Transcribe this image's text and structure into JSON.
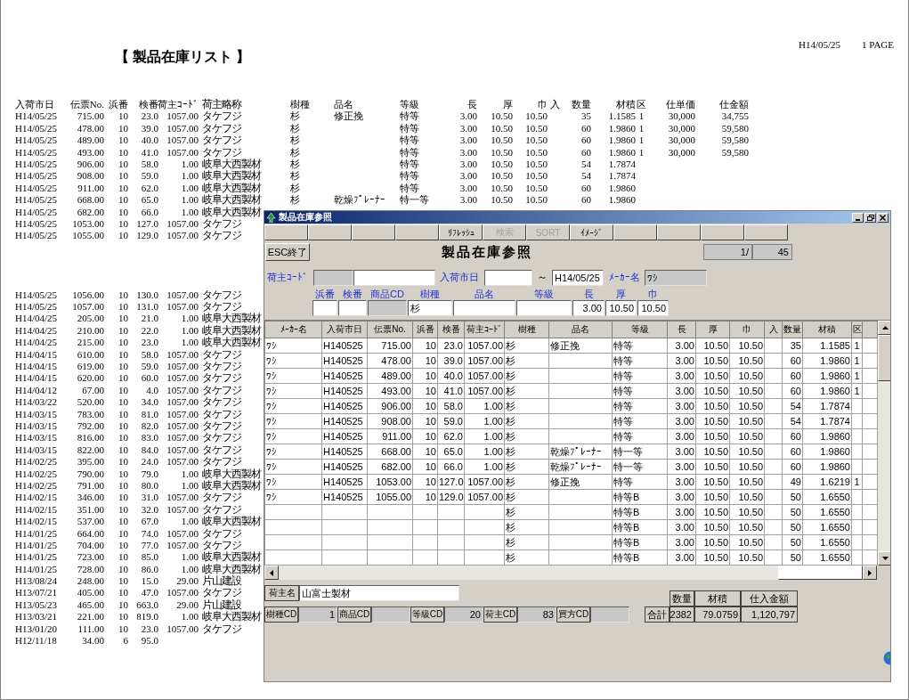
{
  "report": {
    "title": "【 製品在庫リスト 】",
    "date": "H14/05/25",
    "page": "1 PAGE",
    "columns": [
      "入荷市日",
      "伝票No.",
      "浜番",
      "検番",
      "荷主ｺｰﾄﾞ",
      "荷主略称",
      "樹種",
      "品名",
      "等級",
      "長",
      "厚",
      "巾",
      "入",
      "数量",
      "材積",
      "区",
      "仕単価",
      "仕金額"
    ],
    "blocks": [
      {
        "rows": [
          {
            "date": "H14/05/25",
            "slip": "715.00",
            "hama": "10",
            "ken": "23.0",
            "code": "1057.00",
            "owner": "タケフジ",
            "species": "杉",
            "item": "修正挽",
            "grade": "特等",
            "len": "3.00",
            "thk": "10.50",
            "wid": "10.50",
            "qty": "35",
            "vol": "1.1585",
            "ku": "1",
            "price": "30,000",
            "amount": "34,755"
          },
          {
            "date": "H14/05/25",
            "slip": "478.00",
            "hama": "10",
            "ken": "39.0",
            "code": "1057.00",
            "owner": "タケフジ",
            "species": "杉",
            "grade": "特等",
            "len": "3.00",
            "thk": "10.50",
            "wid": "10.50",
            "qty": "60",
            "vol": "1.9860",
            "ku": "1",
            "price": "30,000",
            "amount": "59,580"
          },
          {
            "date": "H14/05/25",
            "slip": "489.00",
            "hama": "10",
            "ken": "40.0",
            "code": "1057.00",
            "owner": "タケフジ",
            "species": "杉",
            "grade": "特等",
            "len": "3.00",
            "thk": "10.50",
            "wid": "10.50",
            "qty": "60",
            "vol": "1.9860",
            "ku": "1",
            "price": "30,000",
            "amount": "59,580"
          },
          {
            "date": "H14/05/25",
            "slip": "493.00",
            "hama": "10",
            "ken": "41.0",
            "code": "1057.00",
            "owner": "タケフジ",
            "species": "杉",
            "grade": "特等",
            "len": "3.00",
            "thk": "10.50",
            "wid": "10.50",
            "qty": "60",
            "vol": "1.9860",
            "ku": "1",
            "price": "30,000",
            "amount": "59,580"
          },
          {
            "date": "H14/05/25",
            "slip": "906.00",
            "hama": "10",
            "ken": "58.0",
            "code": "1.00",
            "owner": "岐阜大西製材",
            "species": "杉",
            "grade": "特等",
            "len": "3.00",
            "thk": "10.50",
            "wid": "10.50",
            "qty": "54",
            "vol": "1.7874"
          },
          {
            "date": "H14/05/25",
            "slip": "908.00",
            "hama": "10",
            "ken": "59.0",
            "code": "1.00",
            "owner": "岐阜大西製材",
            "species": "杉",
            "grade": "特等",
            "len": "3.00",
            "thk": "10.50",
            "wid": "10.50",
            "qty": "54",
            "vol": "1.7874"
          },
          {
            "date": "H14/05/25",
            "slip": "911.00",
            "hama": "10",
            "ken": "62.0",
            "code": "1.00",
            "owner": "岐阜大西製材",
            "species": "杉",
            "grade": "特等",
            "len": "3.00",
            "thk": "10.50",
            "wid": "10.50",
            "qty": "60",
            "vol": "1.9860"
          },
          {
            "date": "H14/05/25",
            "slip": "668.00",
            "hama": "10",
            "ken": "65.0",
            "code": "1.00",
            "owner": "岐阜大西製材",
            "species": "杉",
            "item": "乾燥ﾌﾟﾚｰﾅｰ",
            "grade": "特一等",
            "len": "3.00",
            "thk": "10.50",
            "wid": "10.50",
            "qty": "60",
            "vol": "1.9860"
          },
          {
            "date": "H14/05/25",
            "slip": "682.00",
            "hama": "10",
            "ken": "66.0",
            "code": "1.00",
            "owner": "岐阜大西製材"
          },
          {
            "date": "H14/05/25",
            "slip": "1053.00",
            "hama": "10",
            "ken": "127.0",
            "code": "1057.00",
            "owner": "タケフジ"
          },
          {
            "date": "H14/05/25",
            "slip": "1055.00",
            "hama": "10",
            "ken": "129.0",
            "code": "1057.00",
            "owner": "タケフジ"
          }
        ]
      },
      {
        "rows": [
          {
            "date": "H14/05/25",
            "slip": "1056.00",
            "hama": "10",
            "ken": "130.0",
            "code": "1057.00",
            "owner": "タケフジ"
          },
          {
            "date": "H14/05/25",
            "slip": "1057.00",
            "hama": "10",
            "ken": "131.0",
            "code": "1057.00",
            "owner": "タケフジ"
          },
          {
            "date": "H14/04/25",
            "slip": "205.00",
            "hama": "10",
            "ken": "21.0",
            "code": "1.00",
            "owner": "岐阜大西製材"
          },
          {
            "date": "H14/04/25",
            "slip": "210.00",
            "hama": "10",
            "ken": "22.0",
            "code": "1.00",
            "owner": "岐阜大西製材"
          },
          {
            "date": "H14/04/25",
            "slip": "215.00",
            "hama": "10",
            "ken": "23.0",
            "code": "1.00",
            "owner": "岐阜大西製材"
          },
          {
            "date": "H14/04/15",
            "slip": "610.00",
            "hama": "10",
            "ken": "58.0",
            "code": "1057.00",
            "owner": "タケフジ"
          },
          {
            "date": "H14/04/15",
            "slip": "619.00",
            "hama": "10",
            "ken": "59.0",
            "code": "1057.00",
            "owner": "タケフジ"
          },
          {
            "date": "H14/04/15",
            "slip": "620.00",
            "hama": "10",
            "ken": "60.0",
            "code": "1057.00",
            "owner": "タケフジ"
          },
          {
            "date": "H14/04/12",
            "slip": "67.00",
            "hama": "10",
            "ken": "4.0",
            "code": "1057.00",
            "owner": "タケフジ"
          },
          {
            "date": "H14/03/22",
            "slip": "520.00",
            "hama": "10",
            "ken": "34.0",
            "code": "1057.00",
            "owner": "タケフジ"
          },
          {
            "date": "H14/03/15",
            "slip": "783.00",
            "hama": "10",
            "ken": "81.0",
            "code": "1057.00",
            "owner": "タケフジ"
          },
          {
            "date": "H14/03/15",
            "slip": "792.00",
            "hama": "10",
            "ken": "82.0",
            "code": "1057.00",
            "owner": "タケフジ"
          },
          {
            "date": "H14/03/15",
            "slip": "816.00",
            "hama": "10",
            "ken": "83.0",
            "code": "1057.00",
            "owner": "タケフジ"
          },
          {
            "date": "H14/03/15",
            "slip": "822.00",
            "hama": "10",
            "ken": "84.0",
            "code": "1057.00",
            "owner": "タケフジ"
          },
          {
            "date": "H14/02/25",
            "slip": "395.00",
            "hama": "10",
            "ken": "24.0",
            "code": "1057.00",
            "owner": "タケフジ"
          },
          {
            "date": "H14/02/25",
            "slip": "790.00",
            "hama": "10",
            "ken": "79.0",
            "code": "1.00",
            "owner": "岐阜大西製材"
          },
          {
            "date": "H14/02/25",
            "slip": "791.00",
            "hama": "10",
            "ken": "80.0",
            "code": "1.00",
            "owner": "岐阜大西製材"
          },
          {
            "date": "H14/02/15",
            "slip": "346.00",
            "hama": "10",
            "ken": "31.0",
            "code": "1057.00",
            "owner": "タケフジ"
          },
          {
            "date": "H14/02/15",
            "slip": "351.00",
            "hama": "10",
            "ken": "32.0",
            "code": "1057.00",
            "owner": "タケフジ"
          },
          {
            "date": "H14/02/15",
            "slip": "537.00",
            "hama": "10",
            "ken": "67.0",
            "code": "1.00",
            "owner": "岐阜大西製材"
          },
          {
            "date": "H14/01/25",
            "slip": "664.00",
            "hama": "10",
            "ken": "74.0",
            "code": "1057.00",
            "owner": "タケフジ"
          },
          {
            "date": "H14/01/25",
            "slip": "704.00",
            "hama": "10",
            "ken": "77.0",
            "code": "1057.00",
            "owner": "タケフジ"
          },
          {
            "date": "H14/01/25",
            "slip": "723.00",
            "hama": "10",
            "ken": "85.0",
            "code": "1.00",
            "owner": "岐阜大西製材"
          },
          {
            "date": "H14/01/25",
            "slip": "728.00",
            "hama": "10",
            "ken": "86.0",
            "code": "1.00",
            "owner": "岐阜大西製材"
          },
          {
            "date": "H13/08/24",
            "slip": "248.00",
            "hama": "10",
            "ken": "15.0",
            "code": "29.00",
            "owner": "片山建設"
          },
          {
            "date": "H13/07/21",
            "slip": "405.00",
            "hama": "10",
            "ken": "47.0",
            "code": "1057.00",
            "owner": "タケフジ"
          },
          {
            "date": "H13/05/23",
            "slip": "465.00",
            "hama": "10",
            "ken": "663.0",
            "code": "29.00",
            "owner": "片山建設"
          },
          {
            "date": "H13/03/21",
            "slip": "221.00",
            "hama": "10",
            "ken": "819.0",
            "code": "1.00",
            "owner": "岐阜大西製材"
          },
          {
            "date": "H13/01/20",
            "slip": "111.00",
            "hama": "10",
            "ken": "23.0",
            "code": "1057.00",
            "owner": "タケフジ"
          },
          {
            "date": "H12/11/18",
            "slip": "34.00",
            "hama": "6",
            "ken": "95.0"
          }
        ]
      }
    ]
  },
  "window": {
    "title": "製品在庫参照",
    "toolbar": [
      {
        "kind": "blank"
      },
      {
        "kind": "blank"
      },
      {
        "kind": "blank"
      },
      {
        "kind": "blank"
      },
      {
        "kind": "button",
        "label": "ﾘﾌﾚｯｼｭ",
        "disabled": false
      },
      {
        "kind": "button",
        "label": "検索",
        "disabled": true
      },
      {
        "kind": "button",
        "label": "SORT",
        "disabled": true
      },
      {
        "kind": "button",
        "label": "ｲﾒｰｼﾞ",
        "disabled": false
      },
      {
        "kind": "blank"
      },
      {
        "kind": "blank"
      },
      {
        "kind": "blank"
      },
      {
        "kind": "blank"
      }
    ],
    "exit_button": "ESC終了",
    "heading": "製品在庫参照",
    "pager": {
      "current": "1",
      "separator": "/",
      "total": "45"
    },
    "filters": {
      "owner_code_label": "荷主ｺｰﾄﾞ",
      "date_label": "入荷市日",
      "tilde": "～",
      "date_to": "H14/05/25",
      "maker_label": "ﾒｰｶｰ名",
      "maker": "ﾜｼ"
    },
    "criteria": [
      {
        "label": "浜番",
        "disabled": false
      },
      {
        "label": "検番",
        "disabled": false
      },
      {
        "label": "商品CD",
        "disabled": true
      },
      {
        "label": "樹種",
        "value": "杉",
        "disabled": false
      },
      {
        "label": "品名",
        "disabled": false
      },
      {
        "label": "等級",
        "disabled": false
      },
      {
        "label": "長",
        "value": "3.00",
        "disabled": false
      },
      {
        "label": "厚",
        "value": "10.50",
        "disabled": false
      },
      {
        "label": "巾",
        "value": "10.50",
        "disabled": false
      }
    ],
    "grid": {
      "columns": [
        "ﾒｰｶｰ名",
        "入荷市日",
        "伝票No.",
        "浜番",
        "検番",
        "荷主ｺｰﾄﾞ",
        "樹種",
        "品名",
        "等級",
        "長",
        "厚",
        "巾",
        "入",
        "数量",
        "材積",
        "区"
      ],
      "rows": [
        {
          "maker": "ﾜｼ",
          "date": "H140525",
          "slip": "715.00",
          "hama": "10",
          "ken": "23.0",
          "code": "1057.00",
          "species": "杉",
          "item": "修正挽",
          "grade": "特等",
          "len": "3.00",
          "thk": "10.50",
          "wid": "10.50",
          "qty": "35",
          "vol": "1.1585",
          "ku": "1"
        },
        {
          "maker": "ﾜｼ",
          "date": "H140525",
          "slip": "478.00",
          "hama": "10",
          "ken": "39.0",
          "code": "1057.00",
          "species": "杉",
          "grade": "特等",
          "len": "3.00",
          "thk": "10.50",
          "wid": "10.50",
          "qty": "60",
          "vol": "1.9860",
          "ku": "1"
        },
        {
          "maker": "ﾜｼ",
          "date": "H140525",
          "slip": "489.00",
          "hama": "10",
          "ken": "40.0",
          "code": "1057.00",
          "species": "杉",
          "grade": "特等",
          "len": "3.00",
          "thk": "10.50",
          "wid": "10.50",
          "qty": "60",
          "vol": "1.9860",
          "ku": "1"
        },
        {
          "maker": "ﾜｼ",
          "date": "H140525",
          "slip": "493.00",
          "hama": "10",
          "ken": "41.0",
          "code": "1057.00",
          "species": "杉",
          "grade": "特等",
          "len": "3.00",
          "thk": "10.50",
          "wid": "10.50",
          "qty": "60",
          "vol": "1.9860",
          "ku": "1"
        },
        {
          "maker": "ﾜｼ",
          "date": "H140525",
          "slip": "906.00",
          "hama": "10",
          "ken": "58.0",
          "code": "1.00",
          "species": "杉",
          "grade": "特等",
          "len": "3.00",
          "thk": "10.50",
          "wid": "10.50",
          "qty": "54",
          "vol": "1.7874"
        },
        {
          "maker": "ﾜｼ",
          "date": "H140525",
          "slip": "908.00",
          "hama": "10",
          "ken": "59.0",
          "code": "1.00",
          "species": "杉",
          "grade": "特等",
          "len": "3.00",
          "thk": "10.50",
          "wid": "10.50",
          "qty": "54",
          "vol": "1.7874"
        },
        {
          "maker": "ﾜｼ",
          "date": "H140525",
          "slip": "911.00",
          "hama": "10",
          "ken": "62.0",
          "code": "1.00",
          "species": "杉",
          "grade": "特等",
          "len": "3.00",
          "thk": "10.50",
          "wid": "10.50",
          "qty": "60",
          "vol": "1.9860"
        },
        {
          "maker": "ﾜｼ",
          "date": "H140525",
          "slip": "668.00",
          "hama": "10",
          "ken": "65.0",
          "code": "1.00",
          "species": "杉",
          "item": "乾燥ﾌﾟﾚｰﾅｰ",
          "grade": "特一等",
          "len": "3.00",
          "thk": "10.50",
          "wid": "10.50",
          "qty": "60",
          "vol": "1.9860"
        },
        {
          "maker": "ﾜｼ",
          "date": "H140525",
          "slip": "682.00",
          "hama": "10",
          "ken": "66.0",
          "code": "1.00",
          "species": "杉",
          "item": "乾燥ﾌﾟﾚｰﾅｰ",
          "grade": "特一等",
          "len": "3.00",
          "thk": "10.50",
          "wid": "10.50",
          "qty": "60",
          "vol": "1.9860"
        },
        {
          "maker": "ﾜｼ",
          "date": "H140525",
          "slip": "1053.00",
          "hama": "10",
          "ken": "127.0",
          "code": "1057.00",
          "species": "杉",
          "item": "修正挽",
          "grade": "特等",
          "len": "3.00",
          "thk": "10.50",
          "wid": "10.50",
          "qty": "49",
          "vol": "1.6219",
          "ku": "1"
        },
        {
          "maker": "ﾜｼ",
          "date": "H140525",
          "slip": "1055.00",
          "hama": "10",
          "ken": "129.0",
          "code": "1057.00",
          "species": "杉",
          "grade": "特等B",
          "len": "3.00",
          "thk": "10.50",
          "wid": "10.50",
          "qty": "50",
          "vol": "1.6550"
        },
        {
          "species": "杉",
          "grade": "特等B",
          "len": "3.00",
          "thk": "10.50",
          "wid": "10.50",
          "qty": "50",
          "vol": "1.6550"
        },
        {
          "species": "杉",
          "grade": "特等B",
          "len": "3.00",
          "thk": "10.50",
          "wid": "10.50",
          "qty": "50",
          "vol": "1.6550"
        },
        {
          "species": "杉",
          "grade": "特等B",
          "len": "3.00",
          "thk": "10.50",
          "wid": "10.50",
          "qty": "50",
          "vol": "1.6550"
        },
        {
          "species": "杉",
          "grade": "特等B",
          "len": "3.00",
          "thk": "10.50",
          "wid": "10.50",
          "qty": "50",
          "vol": "1.6550"
        }
      ]
    },
    "owner_name": {
      "label": "荷主名",
      "value": "山富士製材"
    },
    "codes": [
      {
        "label": "樹種CD",
        "value": "1"
      },
      {
        "label": "商品CD"
      },
      {
        "label": "等級CD",
        "value": "20"
      },
      {
        "label": "荷主CD",
        "value": "83"
      },
      {
        "label": "買方CD"
      }
    ],
    "totals": {
      "label": "合計",
      "columns": [
        "数量",
        "材積",
        "仕入金額"
      ],
      "values": [
        "2382",
        "79.0759",
        "1,120,797"
      ]
    }
  }
}
